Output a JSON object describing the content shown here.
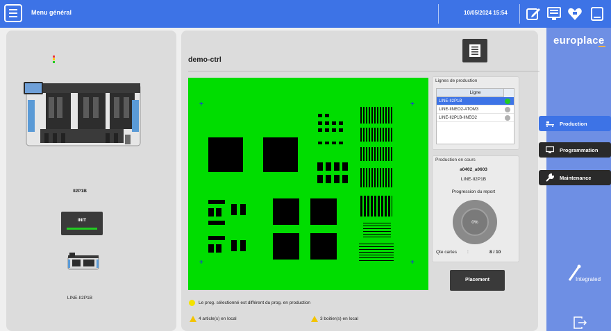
{
  "header": {
    "menu_label": "Menu général",
    "datetime": "10/05/2024 15:54",
    "icons": [
      "menu-icon",
      "edit-icon",
      "monitor-list-icon",
      "heart-logo-icon",
      "window-icon"
    ]
  },
  "colors": {
    "accent": "#3d73e6",
    "sidebar": "#6e8fe4",
    "board": "#00dd00",
    "dark_button": "#3a3a3a",
    "ok": "#22cc22",
    "warning": "#f3c400"
  },
  "sidebar": {
    "brand": "europlace",
    "items": [
      {
        "label": "Production",
        "icon": "conveyor-icon",
        "active": true
      },
      {
        "label": "Programmation",
        "icon": "monitor-icon",
        "active": false
      },
      {
        "label": "Maintenance",
        "icon": "wrench-icon",
        "active": false
      }
    ],
    "integrated_label": "Integrated",
    "exit_icon": "exit-icon"
  },
  "machine": {
    "name": "II2P1B",
    "init_label": "INIT",
    "line_name": "LINE-II2P1B"
  },
  "program": {
    "title": "demo-ctrl"
  },
  "lines": {
    "title": "Lignes de production",
    "header": "Ligne",
    "rows": [
      {
        "name": "LINE-II2P1B",
        "status": "green"
      },
      {
        "name": "LINE-IINEO2-ATOM3",
        "status": "gray"
      },
      {
        "name": "LINE-II2P1B-IINEO2",
        "status": "gray"
      }
    ]
  },
  "current": {
    "title": "Production en cours",
    "program": "a0402_a0603",
    "line": "LINE-II2P1B",
    "progress_label": "Progression du report",
    "progress_percent": "0%",
    "qty_label": "Qte cartes",
    "qty_colon": ":",
    "qty_value": "8 / 10"
  },
  "placement_label": "Placement",
  "messages": {
    "prog_diff": "Le prog. sélectionné est différent du prog. en production",
    "articles_local": "4 article(s) en local",
    "boitiers_local": "3 boitier(s) en local"
  }
}
